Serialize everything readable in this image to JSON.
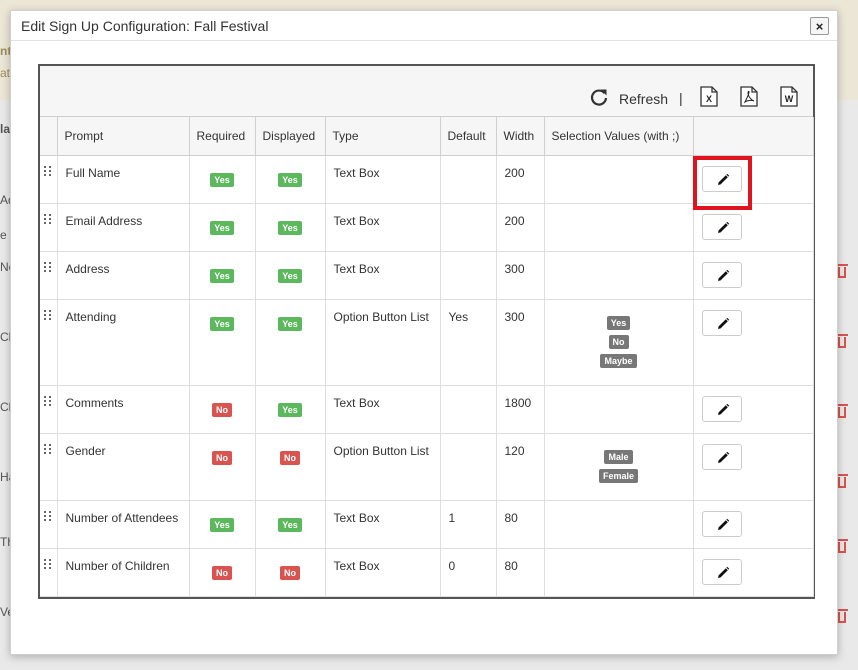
{
  "dialog": {
    "title": "Edit Sign Up Configuration: Fall Festival",
    "close_label": "×"
  },
  "toolbar": {
    "refresh_label": "Refresh",
    "separator": "|",
    "export_icons": [
      "excel-export-icon",
      "pdf-export-icon",
      "word-export-icon"
    ],
    "export_letters": [
      "X",
      "",
      "W"
    ]
  },
  "columns": [
    "Prompt",
    "Required",
    "Displayed",
    "Type",
    "Default",
    "Width",
    "Selection Values (with ;)"
  ],
  "rows": [
    {
      "prompt": "Full Name",
      "required": "Yes",
      "displayed": "Yes",
      "type": "Text Box",
      "default": "",
      "width": "200",
      "selection": []
    },
    {
      "prompt": "Email Address",
      "required": "Yes",
      "displayed": "Yes",
      "type": "Text Box",
      "default": "",
      "width": "200",
      "selection": []
    },
    {
      "prompt": "Address",
      "required": "Yes",
      "displayed": "Yes",
      "type": "Text Box",
      "default": "",
      "width": "300",
      "selection": []
    },
    {
      "prompt": "Attending",
      "required": "Yes",
      "displayed": "Yes",
      "type": "Option Button List",
      "default": "Yes",
      "width": "300",
      "selection": [
        "Yes",
        "No",
        "Maybe"
      ]
    },
    {
      "prompt": "Comments",
      "required": "No",
      "displayed": "Yes",
      "type": "Text Box",
      "default": "",
      "width": "1800",
      "selection": []
    },
    {
      "prompt": "Gender",
      "required": "No",
      "displayed": "No",
      "type": "Option Button List",
      "default": "",
      "width": "120",
      "selection": [
        "Male",
        "Female"
      ]
    },
    {
      "prompt": "Number of Attendees",
      "required": "Yes",
      "displayed": "Yes",
      "type": "Text Box",
      "default": "1",
      "width": "80",
      "selection": []
    },
    {
      "prompt": "Number of Children",
      "required": "No",
      "displayed": "No",
      "type": "Text Box",
      "default": "0",
      "width": "80",
      "selection": []
    }
  ],
  "background": {
    "fragments": [
      "nts",
      "ate",
      "la",
      "Ad",
      "e",
      "Ne",
      "Ch",
      "Ch",
      "Ha",
      "Th",
      "Ve"
    ]
  },
  "colors": {
    "yes_badge": "#5cb85c",
    "no_badge": "#d9534f",
    "chip": "#777777",
    "highlight": "#e0141e"
  }
}
